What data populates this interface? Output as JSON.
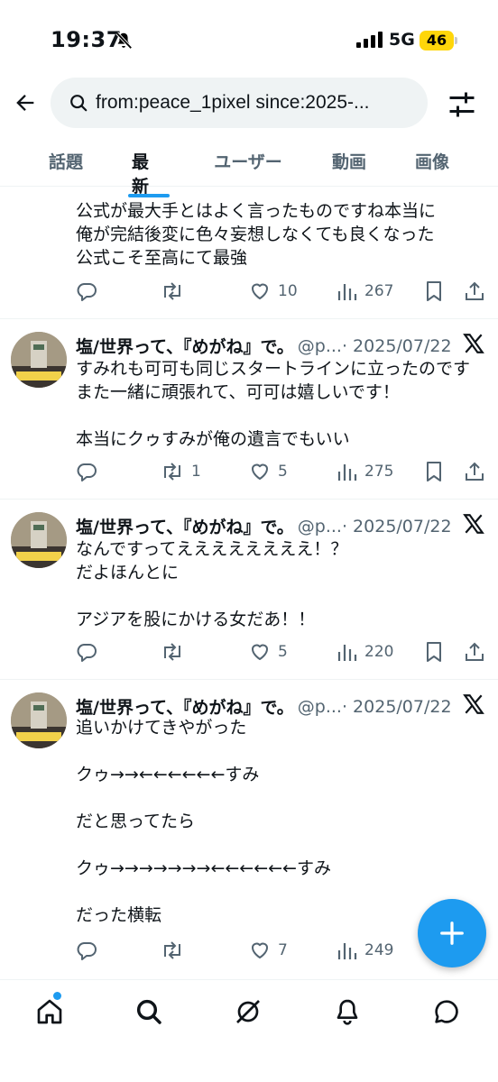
{
  "status_bar": {
    "time": "19:37",
    "network": "5G",
    "battery": "46"
  },
  "search": {
    "query": "from:peace_1pixel since:2025-..."
  },
  "tabs": [
    {
      "label": "話題",
      "active": false
    },
    {
      "label": "最新",
      "active": true
    },
    {
      "label": "ユーザー",
      "active": false
    },
    {
      "label": "動画",
      "active": false
    },
    {
      "label": "画像",
      "active": false
    }
  ],
  "tweets": [
    {
      "text": "公式が最大手とはよく言ったものですね本当に\n俺が完結後変に色々妄想しなくても良くなった\n公式こそ至高にて最強",
      "replies": "",
      "retweets": "",
      "likes": "10",
      "views": "267"
    },
    {
      "name": "塩/世界って、『めがね』で。",
      "handle": "@p...",
      "date": "· 2025/07/22",
      "text": "すみれも可可も同じスタートラインに立ったのです\nまた一緒に頑張れて、可可は嬉しいです！\n\n本当にクゥすみが俺の遺言でもいい",
      "replies": "",
      "retweets": "1",
      "likes": "5",
      "views": "275"
    },
    {
      "name": "塩/世界って、『めがね』で。",
      "handle": "@p...",
      "date": "· 2025/07/22",
      "text": "なんですってええええええええ！？\nだよほんとに\n\nアジアを股にかける女だあ！！",
      "replies": "",
      "retweets": "",
      "likes": "5",
      "views": "220"
    },
    {
      "name": "塩/世界って、『めがね』で。",
      "handle": "@p...",
      "date": "· 2025/07/22",
      "text": "追いかけてきやがった\n\nクゥ→→←←←←←←すみ\n\nだと思ってたら\n\nクゥ→→→→→→→←←←←←←すみ\n\nだった横転",
      "replies": "",
      "retweets": "",
      "likes": "7",
      "views": "249"
    }
  ],
  "colors": {
    "accent": "#1d9bf0",
    "text": "#0f1419",
    "secondary": "#536471",
    "battery": "#ffd60a"
  }
}
